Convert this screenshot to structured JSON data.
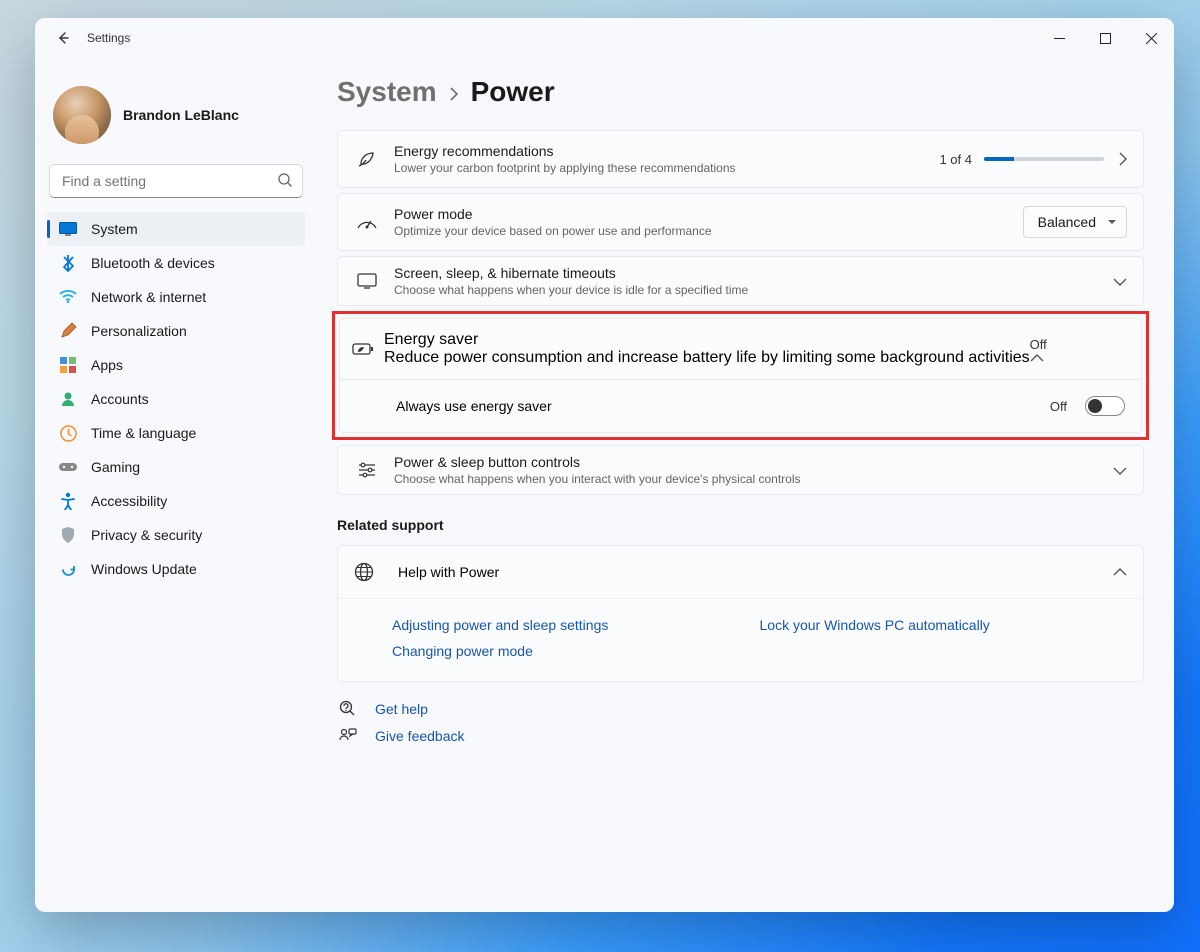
{
  "window": {
    "app_title": "Settings"
  },
  "profile": {
    "username": "Brandon LeBlanc"
  },
  "search": {
    "placeholder": "Find a setting"
  },
  "sidebar": {
    "items": [
      {
        "label": "System",
        "icon": "monitor-icon",
        "active": true
      },
      {
        "label": "Bluetooth & devices",
        "icon": "bluetooth-icon"
      },
      {
        "label": "Network & internet",
        "icon": "wifi-icon"
      },
      {
        "label": "Personalization",
        "icon": "brush-icon"
      },
      {
        "label": "Apps",
        "icon": "apps-icon"
      },
      {
        "label": "Accounts",
        "icon": "person-icon"
      },
      {
        "label": "Time & language",
        "icon": "clock-icon"
      },
      {
        "label": "Gaming",
        "icon": "gamepad-icon"
      },
      {
        "label": "Accessibility",
        "icon": "accessibility-icon"
      },
      {
        "label": "Privacy & security",
        "icon": "shield-icon"
      },
      {
        "label": "Windows Update",
        "icon": "update-icon"
      }
    ]
  },
  "breadcrumb": {
    "parent": "System",
    "current": "Power"
  },
  "cards": {
    "energy_rec": {
      "title": "Energy recommendations",
      "sub": "Lower your carbon footprint by applying these recommendations",
      "progress_text": "1 of 4",
      "progress_pct": 25
    },
    "power_mode": {
      "title": "Power mode",
      "sub": "Optimize your device based on power use and performance",
      "selected": "Balanced"
    },
    "timeouts": {
      "title": "Screen, sleep, & hibernate timeouts",
      "sub": "Choose what happens when your device is idle for a specified time"
    },
    "energy_saver": {
      "title": "Energy saver",
      "sub": "Reduce power consumption and increase battery life by limiting some background activities",
      "status": "Off",
      "toggle_label": "Always use energy saver",
      "toggle_state": "Off"
    },
    "buttons": {
      "title": "Power & sleep button controls",
      "sub": "Choose what happens when you interact with your device's physical controls"
    }
  },
  "related": {
    "heading": "Related support",
    "help_title": "Help with Power",
    "links": [
      "Adjusting power and sleep settings",
      "Lock your Windows PC automatically",
      "Changing power mode"
    ]
  },
  "footer": {
    "get_help": "Get help",
    "feedback": "Give feedback"
  }
}
